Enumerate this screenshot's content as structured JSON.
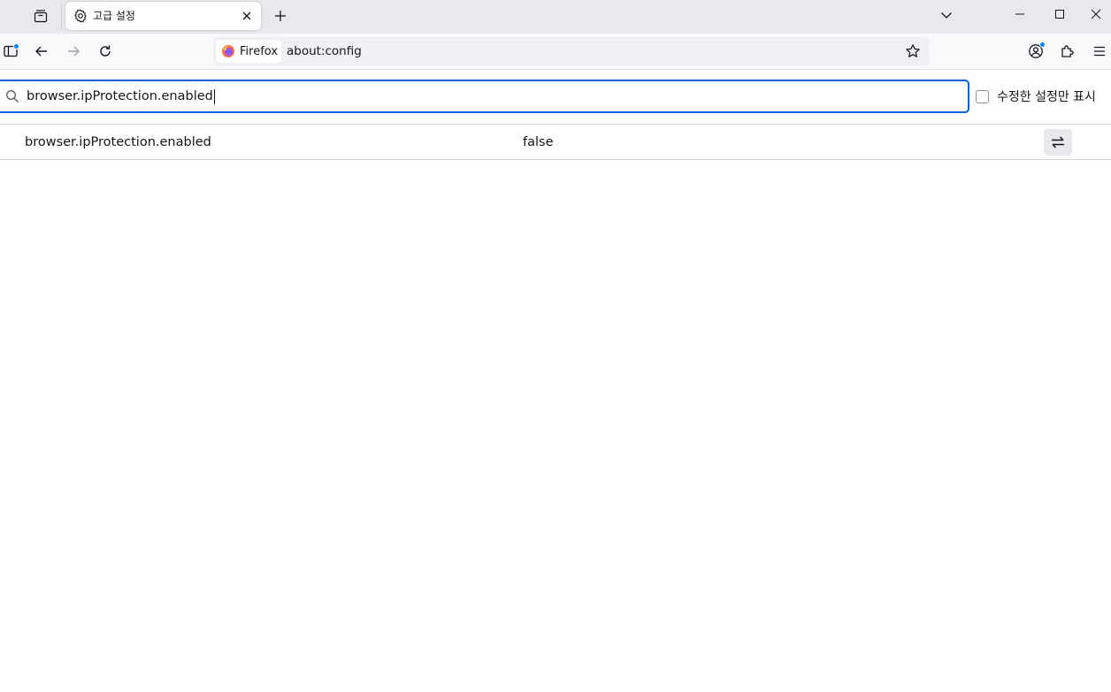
{
  "tab": {
    "title": "고급 설정"
  },
  "identity": {
    "label": "Firefox"
  },
  "url": {
    "text": "about:config"
  },
  "search": {
    "value": "browser.ipProtection.enabled"
  },
  "filter": {
    "modified_only_label": "수정한 설정만 표시"
  },
  "prefs": [
    {
      "name": "browser.ipProtection.enabled",
      "value": "false"
    }
  ],
  "colors": {
    "accent": "#0061e0",
    "badge": "#0a84ff"
  },
  "icons": {
    "tab": "gear-icon",
    "toggle": "swap-arrows-icon"
  }
}
